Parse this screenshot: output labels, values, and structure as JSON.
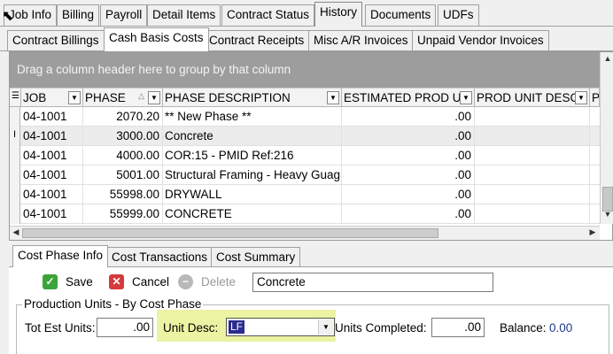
{
  "top_tabs": [
    "Job Info",
    "Billing",
    "Payroll",
    "Detail Items",
    "Contract Status",
    "History",
    "Documents",
    "UDFs"
  ],
  "top_tab_active": "History",
  "sub_tabs": [
    "Contract Billings",
    "Cash Basis Costs",
    "Contract Receipts",
    "Misc A/R Invoices",
    "Unpaid Vendor Invoices"
  ],
  "sub_tab_active": "Cash Basis Costs",
  "grid": {
    "group_hint": "Drag a column header here to group by that column",
    "columns": [
      "JOB",
      "PHASE",
      "PHASE DESCRIPTION",
      "ESTIMATED PROD UI",
      "PROD UNIT DESC",
      "PRO"
    ],
    "rows": [
      {
        "job": "04-1001",
        "phase": "2070.20",
        "desc": "** New Phase **",
        "est": ".00",
        "unit": ""
      },
      {
        "job": "04-1001",
        "phase": "3000.00",
        "desc": "Concrete",
        "est": ".00",
        "unit": ""
      },
      {
        "job": "04-1001",
        "phase": "4000.00",
        "desc": "COR:15 - PMID Ref:216",
        "est": ".00",
        "unit": ""
      },
      {
        "job": "04-1001",
        "phase": "5001.00",
        "desc": "Structural Framing - Heavy Guag",
        "est": ".00",
        "unit": ""
      },
      {
        "job": "04-1001",
        "phase": "55998.00",
        "desc": "DRYWALL",
        "est": ".00",
        "unit": ""
      },
      {
        "job": "04-1001",
        "phase": "55999.00",
        "desc": "CONCRETE",
        "est": ".00",
        "unit": ""
      }
    ],
    "current_row_marker": "I"
  },
  "bottom_tabs": [
    "Cost Phase Info",
    "Cost Transactions",
    "Cost Summary"
  ],
  "bottom_tab_active": "Cost Phase Info",
  "toolbar": {
    "save": "Save",
    "cancel": "Cancel",
    "delete": "Delete",
    "description_value": "Concrete"
  },
  "production": {
    "group_title": "Production Units - By Cost Phase",
    "tot_est_label": "Tot Est Units:",
    "tot_est_value": ".00",
    "unit_desc_label": "Unit Desc:",
    "unit_desc_value": "LF",
    "units_completed_label": "Units Completed:",
    "units_completed_value": ".00",
    "balance_label": "Balance:",
    "balance_value": "0.00"
  },
  "colors": {
    "group_panel": "#9d9d9d",
    "highlight": "#ecf3a2",
    "balance": "#1b3c8c"
  }
}
